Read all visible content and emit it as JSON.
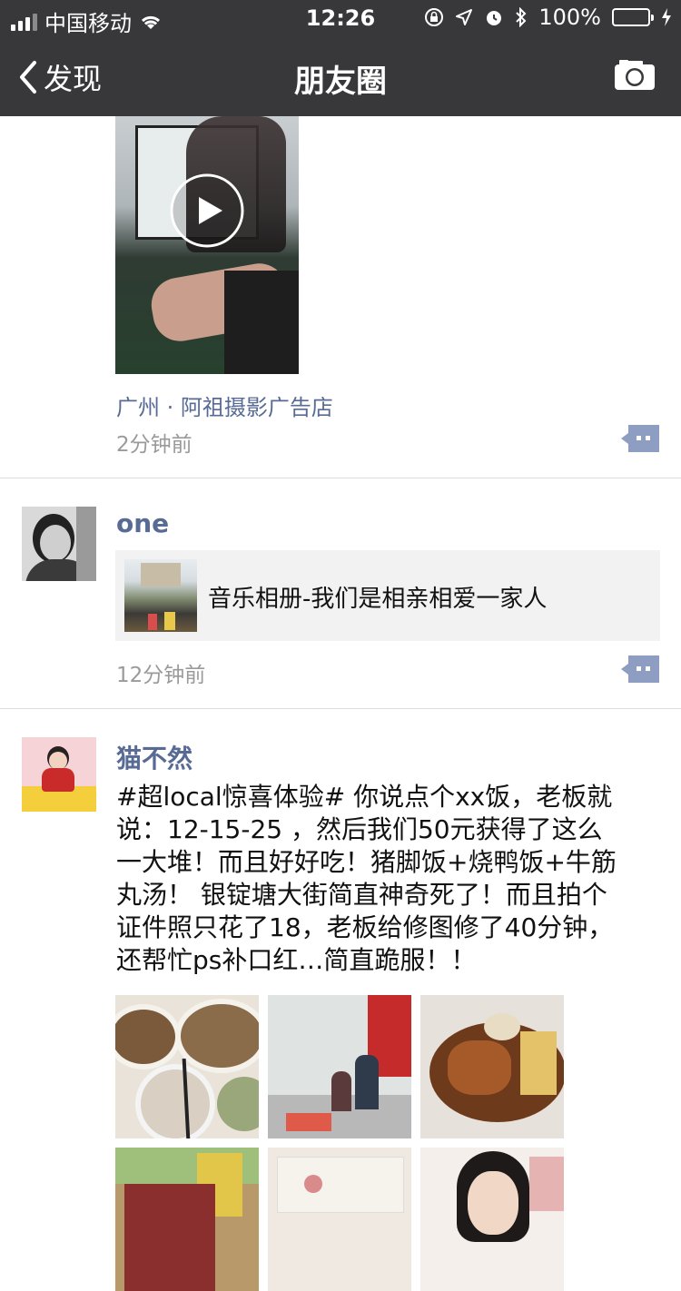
{
  "status_bar": {
    "carrier": "中国移动",
    "time": "12:26",
    "battery": "100%",
    "battery_color": "#4cd964"
  },
  "nav": {
    "back_label": "发现",
    "title": "朋友圈",
    "camera_icon": "camera-icon"
  },
  "posts": [
    {
      "location": "广州 · 阿祖摄影广告店",
      "time": "2分钟前",
      "media": "video"
    },
    {
      "name": "one",
      "share_title": "音乐相册-我们是相亲相爱一家人",
      "time": "12分钟前"
    },
    {
      "name": "猫不然",
      "text_lines": [
        "#超local惊喜体验# 你说点个xx饭，老板就",
        "说：12-15-25 ，然后我们50元获得了这么",
        "一大堆！而且好好吃！猪脚饭+烧鸭饭+牛筋",
        "丸汤！ 银锭塘大街简直神奇死了！而且拍个",
        "证件照只花了18，老板给修图修了40分钟，",
        "还帮忙ps补口红…简直跪服！！"
      ],
      "photo_count_visible": 6
    }
  ],
  "colors": {
    "nav_bg": "#38383b",
    "link": "#586b95",
    "time": "#9a9a9a",
    "action_btn": "#8d9ec2",
    "card_bg": "#f2f2f2"
  }
}
